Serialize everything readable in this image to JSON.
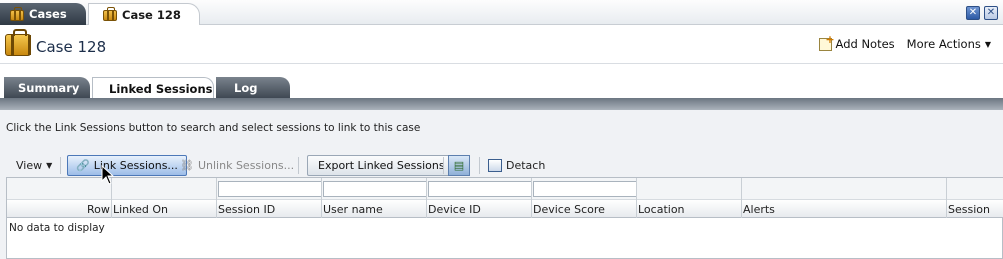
{
  "top_tabs": [
    {
      "label": "Cases"
    },
    {
      "label": "Case 128"
    }
  ],
  "header": {
    "title": "Case 128",
    "add_notes": "Add Notes",
    "more_actions": "More Actions"
  },
  "panel_tabs": [
    {
      "label": "Summary"
    },
    {
      "label": "Linked Sessions"
    },
    {
      "label": "Log"
    }
  ],
  "instructions": "Click the Link Sessions button to search and select sessions to link to this case",
  "toolbar": {
    "view": "View",
    "link_sessions": "Link Sessions...",
    "unlink_sessions": "Unlink Sessions...",
    "export": "Export Linked Sessions",
    "detach": "Detach"
  },
  "table": {
    "columns": [
      "Row",
      "Linked On",
      "Session ID",
      "User name",
      "Device ID",
      "Device Score",
      "Location",
      "Alerts",
      "Session"
    ],
    "empty_text": "No data to display"
  }
}
